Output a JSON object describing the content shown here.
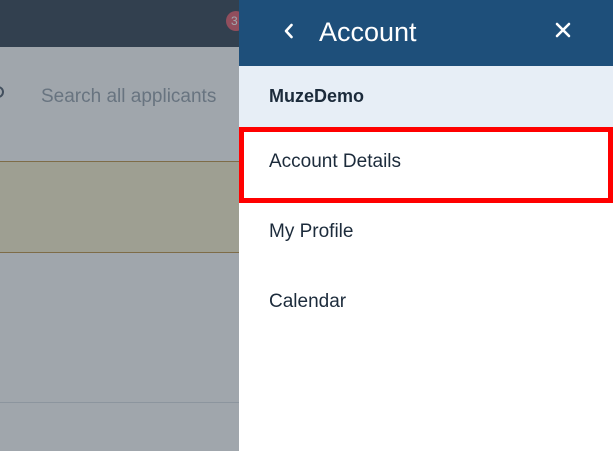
{
  "background": {
    "notification_count": "3",
    "search": {
      "placeholder": "Search all applicants"
    }
  },
  "drawer": {
    "title": "Account",
    "back_icon": "chevron-left-icon",
    "close_icon": "close-icon",
    "account_name": "MuzeDemo",
    "items": [
      {
        "label": "Account Details",
        "highlighted": true
      },
      {
        "label": "My Profile"
      },
      {
        "label": "Calendar"
      }
    ]
  },
  "colors": {
    "header": "#1e4f7a",
    "topbar": "#1a2a3d",
    "account_row": "#e7eef6",
    "highlight": "#ff0000",
    "badge": "#e0485b",
    "text": "#1c2b3b"
  }
}
